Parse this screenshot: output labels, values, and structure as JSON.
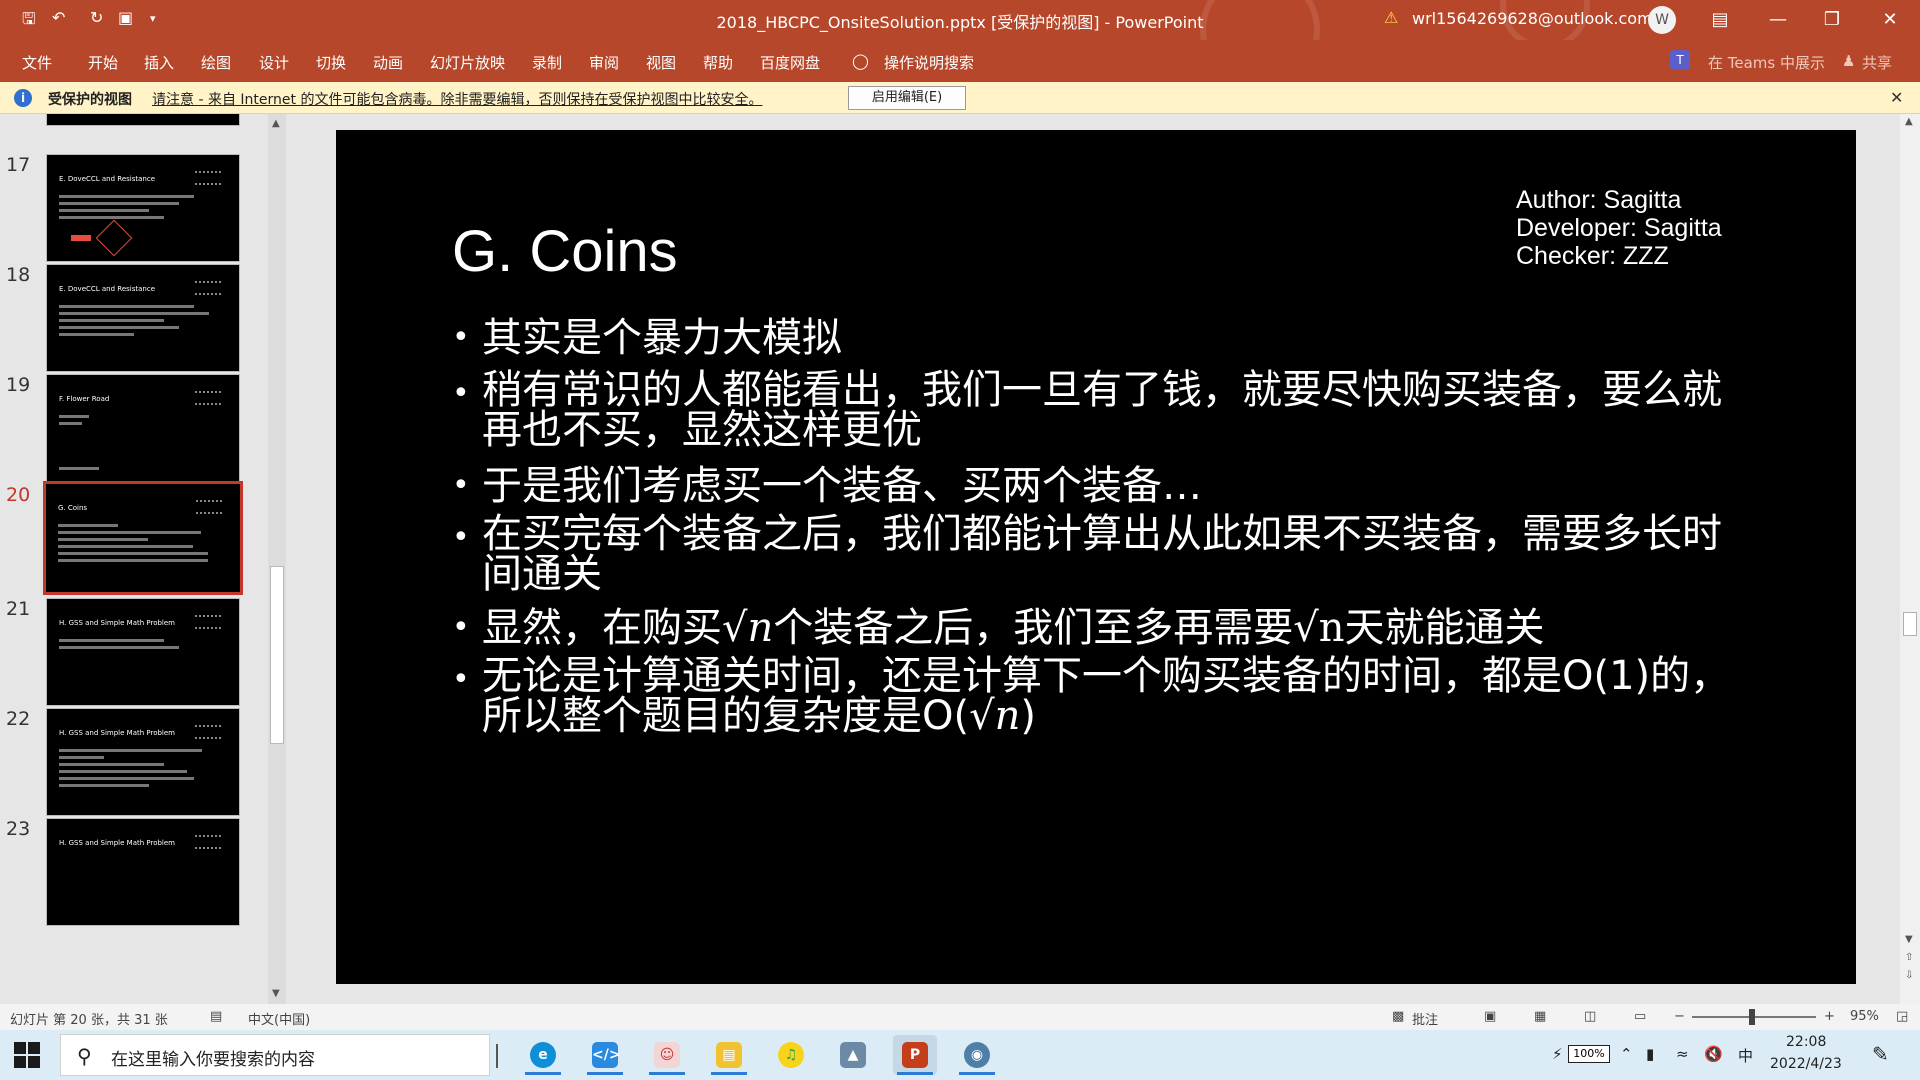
{
  "titlebar": {
    "doc_title": "2018_HBCPC_OnsiteSolution.pptx [受保护的视图] - PowerPoint",
    "account": "wrl1564269628@outlook.com",
    "avatar_initial": "W",
    "icons": [
      "save-icon",
      "undo-icon",
      "redo-icon",
      "present-icon",
      "customize-icon"
    ]
  },
  "ribbon": {
    "tabs": [
      "文件",
      "开始",
      "插入",
      "绘图",
      "设计",
      "切换",
      "动画",
      "幻灯片放映",
      "录制",
      "审阅",
      "视图",
      "帮助",
      "百度网盘"
    ],
    "tell_me": "操作说明搜索",
    "teams": "在 Teams 中展示",
    "share": "共享"
  },
  "protected_view": {
    "title": "受保护的视图",
    "message": "请注意 - 来自 Internet 的文件可能包含病毒。除非需要编辑，否则保持在受保护视图中比较安全。",
    "enable_button": "启用编辑(E)"
  },
  "thumbnails": [
    {
      "num": "17",
      "title": "E. DoveCCL and Resistance"
    },
    {
      "num": "18",
      "title": "E. DoveCCL and Resistance"
    },
    {
      "num": "19",
      "title": "F. Flower Road"
    },
    {
      "num": "20",
      "title": "G. Coins"
    },
    {
      "num": "21",
      "title": "H. GSS and Simple Math Problem"
    },
    {
      "num": "22",
      "title": "H. GSS and Simple Math Problem"
    },
    {
      "num": "23",
      "title": "H. GSS and Simple Math Problem"
    }
  ],
  "slide": {
    "title": "G. Coins",
    "author": "Author: Sagitta",
    "developer": "Developer: Sagitta",
    "checker": "Checker: ZZZ",
    "bullets": {
      "b1": "其实是个暴力大模拟",
      "b2": "稍有常识的人都能看出，我们一旦有了钱，就要尽快购买装备，要么就再也不买，显然这样更优",
      "b3": "于是我们考虑买一个装备、买两个装备…",
      "b4": "在买完每个装备之后，我们都能计算出从此如果不买装备，需要多长时间通关",
      "b5a": "显然，在购买",
      "b5s1": "√n",
      "b5b": "个装备之后，我们至多再需要",
      "b5s2": "√n",
      "b5c": "天就能通关",
      "b6a": "无论是计算通关时间，还是计算下一个购买装备的时间，都是O(1)的，所以整个题目的复杂度是O(",
      "b6s": "√n",
      "b6b": ")"
    }
  },
  "statusbar": {
    "slide_info": "幻灯片 第 20 张，共 31 张",
    "language": "中文(中国)",
    "comments": "批注",
    "zoom": "95%"
  },
  "taskbar": {
    "search_placeholder": "在这里输入你要搜索的内容",
    "apps": [
      "edge",
      "vscode",
      "app-anime",
      "file-explorer",
      "music",
      "photos",
      "powerpoint",
      "globe"
    ],
    "battery": "100%",
    "ime": "中",
    "time": "22:08",
    "date": "2022/4/23"
  },
  "colors": {
    "accent": "#b7472a",
    "selection": "#c0392b",
    "protected_bar": "#fff3c7"
  }
}
